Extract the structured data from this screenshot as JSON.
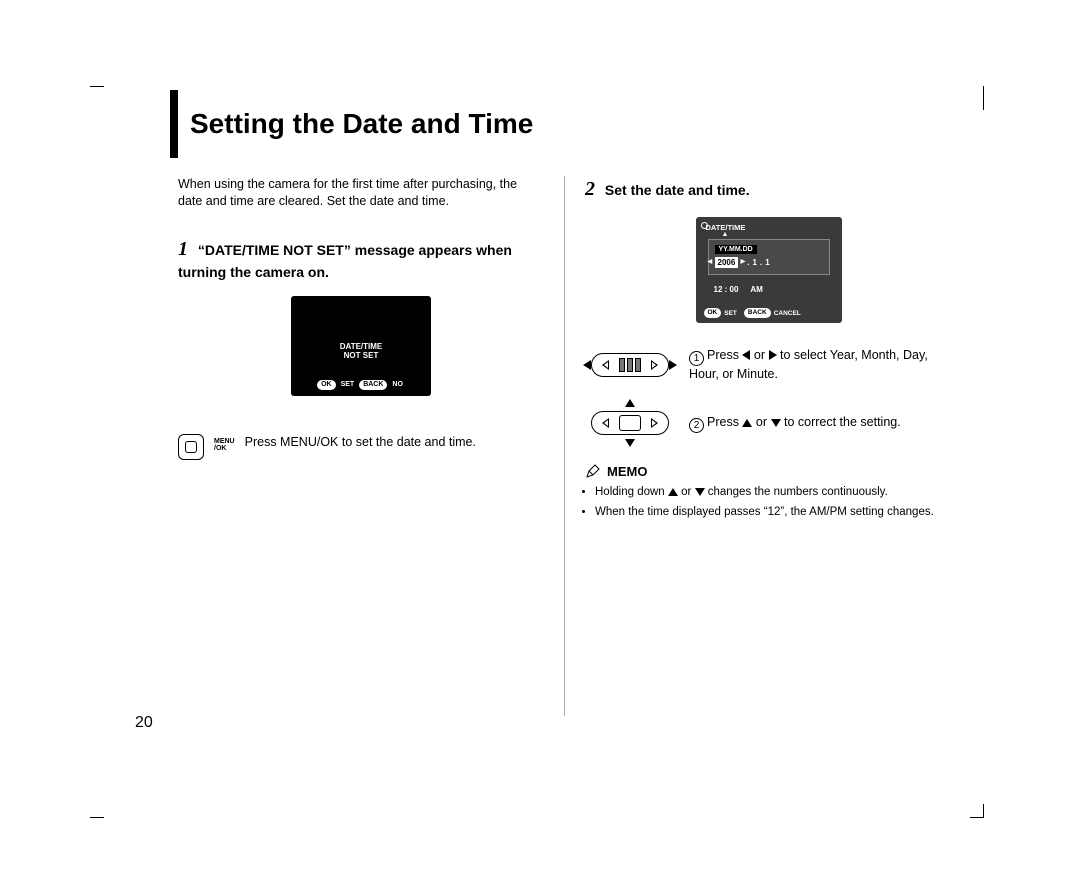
{
  "page_number": "20",
  "title": "Setting the Date and Time",
  "intro": "When using the camera for the first time after purchasing, the date and time are cleared. Set the date and time.",
  "step1": {
    "num": "1",
    "heading": "“DATE/TIME NOT SET” message appears when turning the camera on.",
    "lcd_line1": "DATE/TIME",
    "lcd_line2": "NOT SET",
    "lcd_ok": "OK",
    "lcd_set": "SET",
    "lcd_back": "BACK",
    "lcd_no": "NO",
    "menu_label1": "MENU",
    "menu_label2": "/OK",
    "instruction": "Press MENU/OK to set the date and time."
  },
  "step2": {
    "num": "2",
    "heading": "Set the date and time.",
    "lcd_title": "DATE/TIME",
    "lcd_format": "YY.MM.DD",
    "lcd_year": "2006",
    "lcd_mon": "1",
    "lcd_day": "1",
    "lcd_time": "12 : 00",
    "lcd_ampm": "AM",
    "lcd_ok": "OK",
    "lcd_set": "SET",
    "lcd_back": "BACK",
    "lcd_cancel": "CANCEL",
    "instr1_num": "1",
    "instr1_a": "Press ",
    "instr1_b": " or ",
    "instr1_c": " to select Year, Month, Day, Hour, or Minute.",
    "instr2_num": "2",
    "instr2_a": "Press ",
    "instr2_b": " or ",
    "instr2_c": " to correct the setting.",
    "memo_label": "MEMO",
    "memo1_a": "Holding down ",
    "memo1_b": " or ",
    "memo1_c": " changes the numbers continuously.",
    "memo2": "When the time displayed passes “12”, the AM/PM setting changes."
  }
}
